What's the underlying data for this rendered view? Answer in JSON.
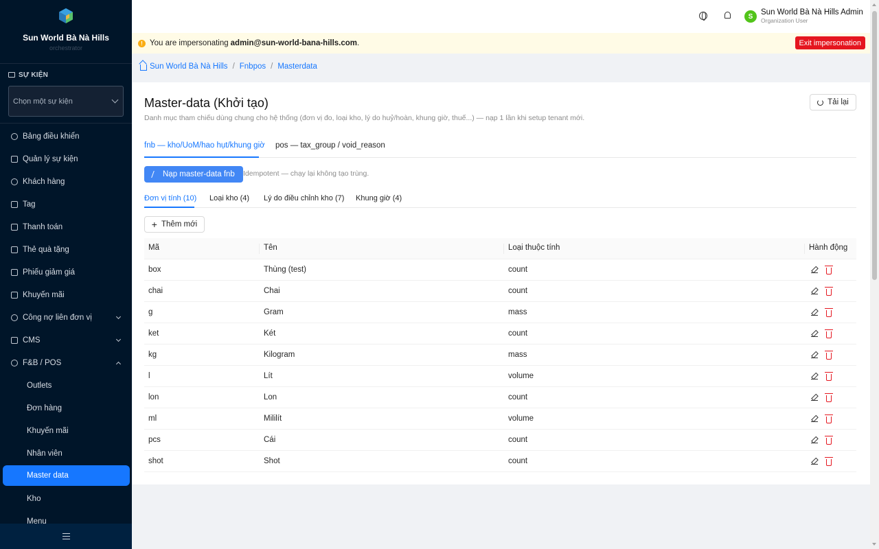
{
  "sidebar": {
    "org_name": "Sun World Bà Nà Hills",
    "org_sub": "orchestrator",
    "section_label": "SỰ KIỆN",
    "event_placeholder": "Chọn một sự kiện",
    "items": [
      {
        "label": "Bảng điều khiển",
        "icon": "dashboard-icon"
      },
      {
        "label": "Quản lý sự kiện",
        "icon": "calendar-icon"
      },
      {
        "label": "Khách hàng",
        "icon": "user-icon"
      },
      {
        "label": "Tag",
        "icon": "tag-icon"
      },
      {
        "label": "Thanh toán",
        "icon": "payment-icon"
      },
      {
        "label": "Thẻ quà tặng",
        "icon": "gift-icon"
      },
      {
        "label": "Phiếu giảm giá",
        "icon": "coupon-icon"
      },
      {
        "label": "Khuyến mãi",
        "icon": "bolt-icon"
      },
      {
        "label": "Công nợ liên đơn vị",
        "icon": "debt-icon"
      },
      {
        "label": "CMS",
        "icon": "cms-icon"
      },
      {
        "label": "F&B / POS",
        "icon": "pos-icon"
      }
    ],
    "fnb_sub_items": [
      "Outlets",
      "Đơn hàng",
      "Khuyến mãi",
      "Nhân viên",
      "Master data",
      "Kho",
      "Menu"
    ]
  },
  "header": {
    "user_name": "Sun World Bà Nà Hills Admin",
    "user_role": "Organization User",
    "avatar_letter": "S"
  },
  "impersonation": {
    "prefix": "You are impersonating",
    "email": "admin@sun-world-bana-hills.com",
    "suffix": ".",
    "exit_label": "Exit impersonation"
  },
  "breadcrumb": [
    "Sun World Bà Nà Hills",
    "Fnbpos",
    "Masterdata"
  ],
  "page": {
    "title": "Master-data (Khởi tạo)",
    "description": "Danh mục tham chiếu dùng chung cho hệ thống (đơn vị đo, loại kho, lý do huỷ/hoàn, khung giờ, thuế...) — nạp 1 lần khi setup tenant mới.",
    "reload_label": "Tải lại",
    "main_tabs": [
      "fnb — kho/UoM/hao hụt/khung giờ",
      "pos — tax_group / void_reason"
    ],
    "seed_label": "Nạp master-data fnb",
    "seed_note": "Idempotent — chạy lại không tạo trùng.",
    "sub_tabs": [
      "Đơn vị tính (10)",
      "Loại kho (4)",
      "Lý do điều chỉnh kho (7)",
      "Khung giờ (4)"
    ],
    "add_label": "Thêm mới"
  },
  "table": {
    "headers": [
      "Mã",
      "Tên",
      "Loại thuộc tính",
      "Hành động"
    ],
    "rows": [
      [
        "box",
        "Thùng (test)",
        "count"
      ],
      [
        "chai",
        "Chai",
        "count"
      ],
      [
        "g",
        "Gram",
        "mass"
      ],
      [
        "ket",
        "Két",
        "count"
      ],
      [
        "kg",
        "Kilogram",
        "mass"
      ],
      [
        "l",
        "Lít",
        "volume"
      ],
      [
        "lon",
        "Lon",
        "count"
      ],
      [
        "ml",
        "Mililít",
        "volume"
      ],
      [
        "pcs",
        "Cái",
        "count"
      ],
      [
        "shot",
        "Shot",
        "count"
      ]
    ]
  },
  "colors": {
    "sidebar_bg": "#001529",
    "primary": "#1677ff",
    "danger": "#e5161f",
    "warning_bg": "#fffbe6"
  }
}
